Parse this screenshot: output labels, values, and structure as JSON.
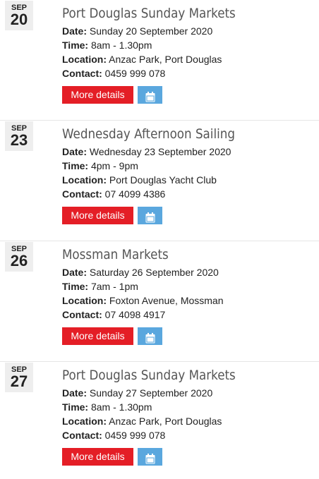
{
  "labels": {
    "date": "Date:",
    "time": "Time:",
    "location": "Location:",
    "contact": "Contact:",
    "more_details": "More details"
  },
  "icons": {
    "calendar": "calendar-icon"
  },
  "colors": {
    "more_button": "#e41e26",
    "calendar_button": "#5aa7de",
    "title": "#555555",
    "date_box": "#eeeeee"
  },
  "events": [
    {
      "month": "SEP",
      "day": "20",
      "title": "Port Douglas Sunday Markets",
      "date": "Sunday 20 September 2020",
      "time": "8am - 1.30pm",
      "location": "Anzac Park, Port Douglas",
      "contact": "0459 999 078"
    },
    {
      "month": "SEP",
      "day": "23",
      "title": "Wednesday Afternoon Sailing",
      "date": "Wednesday 23 September 2020",
      "time": "4pm - 9pm",
      "location": "Port Douglas Yacht Club",
      "contact": "07 4099 4386"
    },
    {
      "month": "SEP",
      "day": "26",
      "title": "Mossman Markets",
      "date": "Saturday 26 September 2020",
      "time": "7am - 1pm",
      "location": "Foxton Avenue, Mossman",
      "contact": "07 4098 4917"
    },
    {
      "month": "SEP",
      "day": "27",
      "title": "Port Douglas Sunday Markets",
      "date": "Sunday 27 September 2020",
      "time": "8am - 1.30pm",
      "location": "Anzac Park, Port Douglas",
      "contact": "0459 999 078"
    }
  ]
}
